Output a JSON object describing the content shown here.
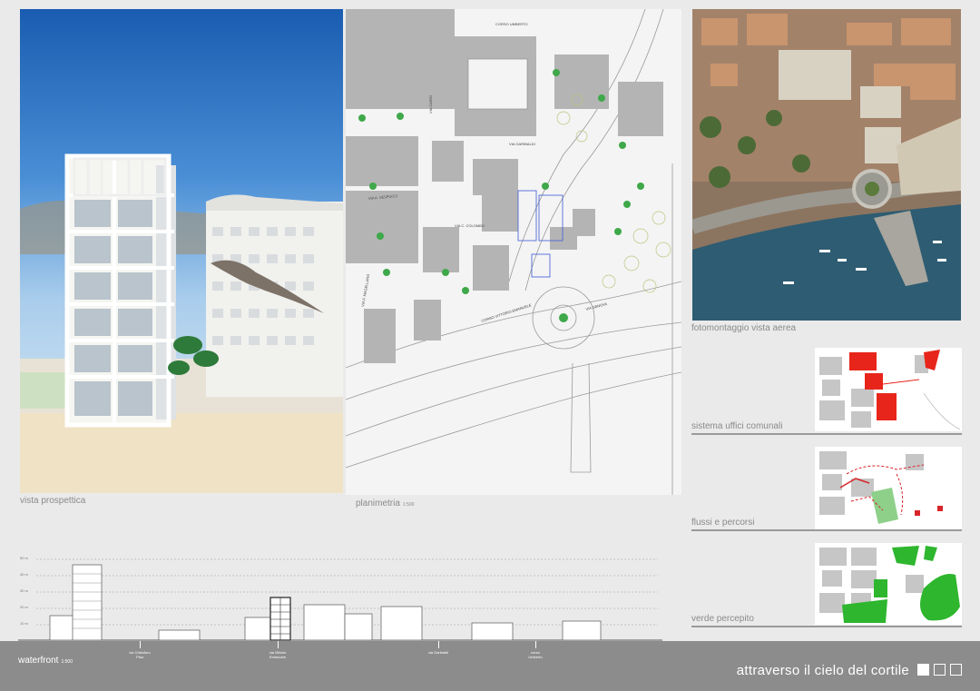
{
  "labels": {
    "perspective": "vista prospettica",
    "plan": "planimetria",
    "plan_scale": "1:500",
    "aerial": "fotomontaggio vista aerea",
    "offices": "sistema uffici comunali",
    "flows": "flussi e percorsi",
    "green": "verde percepito"
  },
  "footer": {
    "section_label": "waterfront",
    "section_scale": "1:500",
    "title": "attraverso il cielo del cortile"
  },
  "section": {
    "heights": [
      "50 m",
      "40 m",
      "30 m",
      "20 m",
      "10 m"
    ],
    "streets": [
      "via Cristoforo Pisa",
      "via Vittorio Emanuele",
      "via Garibaldi",
      "corso Umberto"
    ]
  },
  "plan_streets": [
    "CORSO UMBERTO",
    "VIA GARIBALDI",
    "VIA A. VESPUCCI",
    "VIA C. COLOMBO",
    "CORSO VITTORIO EMANUELE",
    "VIA CAIRO",
    "VIA F. MAGELLANO",
    "VIA GENOVA"
  ],
  "colors": {
    "offices_highlight": "#e8251a",
    "green_highlight": "#2eb62e",
    "footer": "#8c8c8c"
  }
}
